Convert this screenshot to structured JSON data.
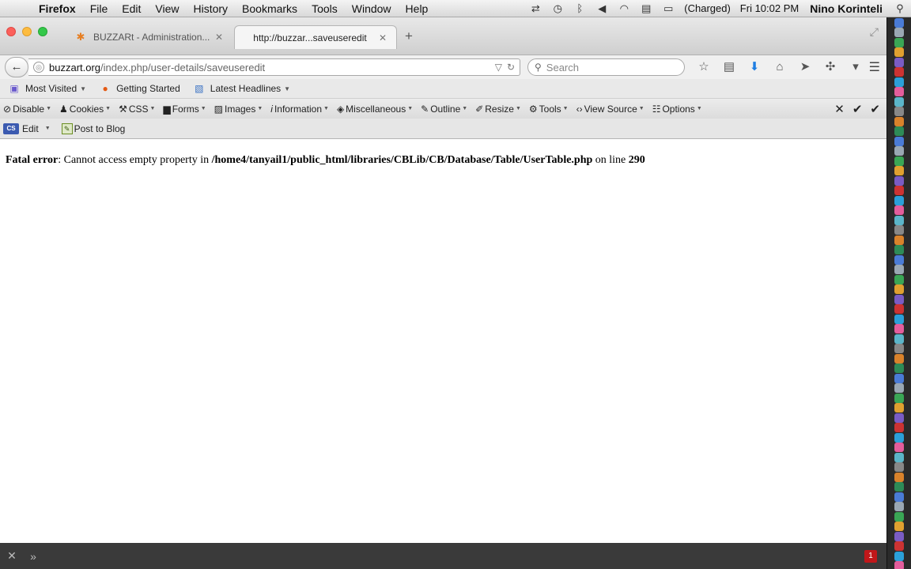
{
  "menubar": {
    "app": "Firefox",
    "items": [
      "File",
      "Edit",
      "View",
      "History",
      "Bookmarks",
      "Tools",
      "Window",
      "Help"
    ],
    "battery": "(Charged)",
    "clock": "Fri 10:02 PM",
    "user": "Nino Korinteli"
  },
  "tabs": [
    {
      "title": "BUZZARt - Administration..."
    },
    {
      "title": "http://buzzar...saveuseredit"
    }
  ],
  "url": {
    "domain": "buzzart.org",
    "path": "/index.php/user-details/saveuseredit"
  },
  "search": {
    "placeholder": "Search"
  },
  "bookmarks": [
    "Most Visited",
    "Getting Started",
    "Latest Headlines"
  ],
  "devtoolbar": [
    "Disable",
    "Cookies",
    "CSS",
    "Forms",
    "Images",
    "Information",
    "Miscellaneous",
    "Outline",
    "Resize",
    "Tools",
    "View Source",
    "Options"
  ],
  "editbar": {
    "edit": "Edit",
    "post": "Post to Blog",
    "cs_badge": "CS"
  },
  "error": {
    "label": "Fatal error",
    "message": ": Cannot access empty property in ",
    "file": "/home4/tanyail1/public_html/libraries/CBLib/CB/Database/Table/UserTable.php",
    "online": " on line ",
    "line": "290"
  },
  "statusbar": {
    "badge": "1"
  },
  "colors": {
    "error_badge": "#c0171a",
    "download_arrow": "#1e7de2"
  }
}
